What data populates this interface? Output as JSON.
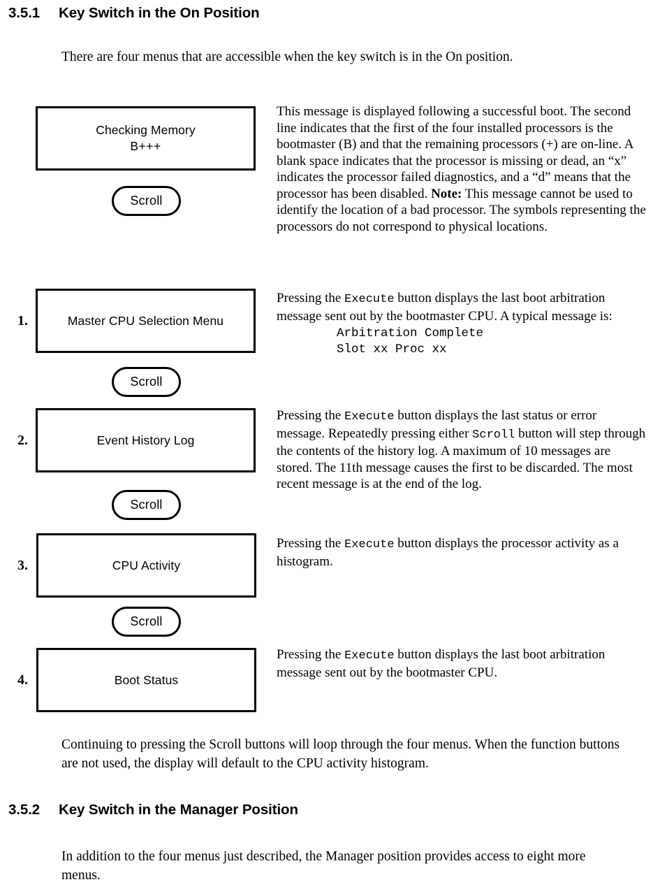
{
  "sections": {
    "first": {
      "number": "3.5.1",
      "title": "Key Switch in the On Position",
      "intro": "There are four menus that are accessible when the key switch is in the On position.",
      "closing": "Continuing to pressing the Scroll buttons will loop through the four menus. When the function buttons are not used, the display will default to the CPU activity histogram."
    },
    "second": {
      "number": "3.5.2",
      "title": "Key Switch in the Manager Position",
      "intro": "In addition to the four menus just described, the Manager  position provides access to eight more menus."
    }
  },
  "diagram": {
    "boxes": [
      {
        "id": "checking-memory",
        "number": "",
        "label_line1": "Checking Memory",
        "label_line2": "B+++"
      },
      {
        "id": "master-cpu-selection-menu",
        "number": "1.",
        "label_line1": "Master CPU Selection Menu",
        "label_line2": ""
      },
      {
        "id": "event-history-log",
        "number": "2.",
        "label_line1": "Event History Log",
        "label_line2": ""
      },
      {
        "id": "cpu-activity",
        "number": "3.",
        "label_line1": "CPU Activity",
        "label_line2": ""
      },
      {
        "id": "boot-status",
        "number": "4.",
        "label_line1": "Boot Status",
        "label_line2": ""
      }
    ],
    "scroll_buttons": [
      {
        "label": "Scroll"
      },
      {
        "label": "Scroll"
      },
      {
        "label": "Scroll"
      },
      {
        "label": "Scroll"
      }
    ]
  },
  "descriptions": {
    "checking_memory": {
      "part1": "This message is displayed following a successful boot. The second line indicates that the first of the four installed processors is the bootmaster (B) and that the remaining processors (+) are on-line. A blank space indicates that the processor is missing or dead, an “x” indicates the processor failed diagnostics, and a “d” means that the processor has been disabled. ",
      "note_label": "Note:",
      "part2": " This message cannot be used to identify the location of a bad processor. The symbols representing the processors do not correspond to physical locations."
    },
    "master_cpu": {
      "pre": "Pressing the ",
      "mono": "Execute",
      "post": " button displays the last boot arbitration message sent out by the bootmaster CPU. A typical message is:",
      "code": "Arbitration Complete\nSlot xx Proc xx"
    },
    "event_history": {
      "pre": "Pressing the ",
      "mono1": "Execute",
      "mid1": " button displays the last status or error message. Repeatedly pressing either ",
      "mono2": "Scroll",
      "post": " button will step through the contents of the history log. A maximum of 10 messages are stored. The 11th message causes the first to be discarded. The most recent message is at the end of the log."
    },
    "cpu_activity": {
      "pre": "Pressing the ",
      "mono": "Execute",
      "post": " button displays the processor activity as a histogram."
    },
    "boot_status": {
      "pre": "Pressing the ",
      "mono": "Execute",
      "post": " button displays the last boot arbitration message sent out by the bootmaster CPU."
    }
  }
}
